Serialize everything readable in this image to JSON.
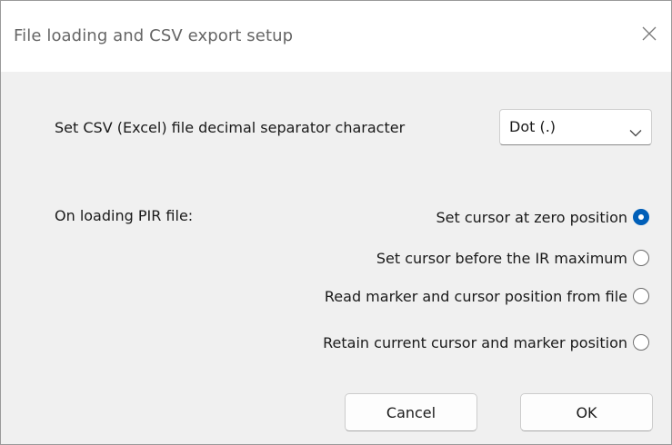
{
  "window": {
    "title": "File loading and CSV export setup",
    "close_icon": "close-icon"
  },
  "separator": {
    "label": "Set CSV (Excel) file decimal separator character",
    "selected": "Dot (.)",
    "dropdown_icon": "chevron-down-icon"
  },
  "pir": {
    "label": "On loading PIR file:",
    "options": [
      {
        "label": "Set cursor at zero position",
        "checked": true
      },
      {
        "label": "Set cursor before the IR maximum",
        "checked": false
      },
      {
        "label": "Read marker and cursor position from file",
        "checked": false
      },
      {
        "label": "Retain current cursor and marker position",
        "checked": false
      }
    ]
  },
  "buttons": {
    "cancel": "Cancel",
    "ok": "OK"
  },
  "colors": {
    "accent": "#005fb8",
    "dialog_bg": "#f0f0f0",
    "titlebar_bg": "#ffffff"
  }
}
